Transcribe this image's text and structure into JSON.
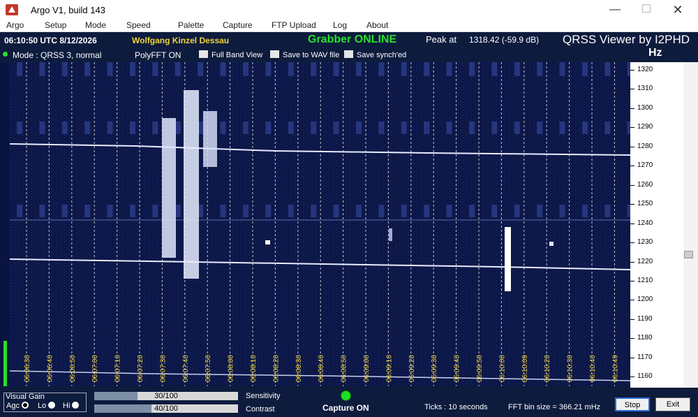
{
  "window": {
    "title": "Argo V1, build 143",
    "controls": {
      "minimize": "—",
      "maximize": "☐",
      "close": "✕"
    }
  },
  "menu": [
    "Argo",
    "Setup",
    "Mode",
    "Speed",
    "Palette",
    "Capture",
    "FTP Upload",
    "Log",
    "About"
  ],
  "header": {
    "utc": "06:10:50 UTC  8/12/2026",
    "operator": "Wolfgang Kinzel Dessau",
    "grabber": "Grabber ONLINE",
    "peak_label": "Peak at",
    "peak_value": "1318.42 (-59.9 dB)",
    "brand": "QRSS Viewer by I2PHD",
    "unit": "Hz"
  },
  "options": {
    "mode": "Mode : QRSS 3, normal",
    "polyfft": "PolyFFT ON",
    "full_band": "Full Band View",
    "save_wav": "Save to WAV file",
    "save_synch": "Save synch'ed"
  },
  "frequency_scale": {
    "min": 1155,
    "max": 1324,
    "labels": [
      "1320",
      "1310",
      "1300",
      "1290",
      "1280",
      "1270",
      "1260",
      "1250",
      "1240",
      "1230",
      "1220",
      "1210",
      "1200",
      "1190",
      "1180",
      "1170",
      "1160"
    ]
  },
  "time_labels": [
    "06:06:30",
    "06:06:40",
    "06:06:50",
    "06:07:00",
    "06:07:10",
    "06:07:20",
    "06:07:30",
    "06:07:40",
    "06:07:50",
    "06:08:00",
    "06:08:10",
    "06:08:20",
    "06:08:30",
    "06:08:40",
    "06:08:50",
    "06:09:00",
    "06:09:10",
    "06:09:20",
    "06:09:30",
    "06:09:40",
    "06:09:50",
    "06:10:00",
    "06:10:09",
    "06:10:20",
    "06:10:30",
    "06:10:40",
    "06:10:49"
  ],
  "colors": {
    "background": "#0d1b3d",
    "spectrogram": "#0a1440",
    "time_label": "#f2d43a",
    "online": "#27e02a",
    "operator": "#f2d43a"
  },
  "gain": {
    "title": "Visual Gain",
    "agc": "Agc",
    "lo": "Lo",
    "hi": "Hi",
    "selected": "Agc"
  },
  "sliders": {
    "sensitivity": {
      "label": "Sensitivity",
      "value_text": "30/100",
      "value": 30
    },
    "contrast": {
      "label": "Contrast",
      "value_text": "40/100",
      "value": 40
    }
  },
  "status": {
    "capture": "Capture ON",
    "ticks": "Ticks  :  10 seconds",
    "fft_bin": "FFT bin size = 366.21 mHz"
  },
  "buttons": {
    "stop": "Stop",
    "exit": "Exit"
  }
}
